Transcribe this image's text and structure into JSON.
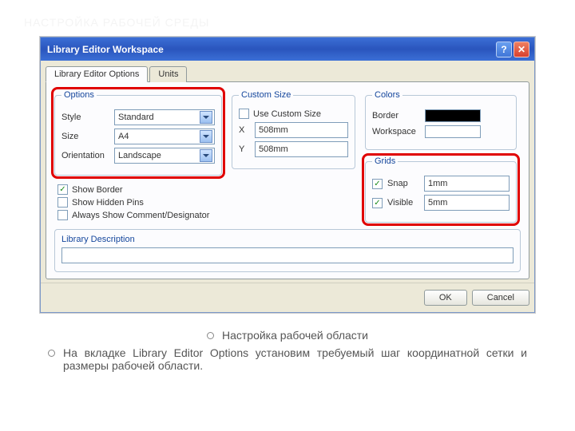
{
  "slide_title": "НАСТРОЙКА РАБОЧЕЙ СРЕДЫ",
  "dialog": {
    "title": "Library Editor Workspace",
    "tabs": {
      "options": "Library Editor Options",
      "units": "Units"
    },
    "options_group": {
      "legend": "Options",
      "style_label": "Style",
      "style_value": "Standard",
      "size_label": "Size",
      "size_value": "A4",
      "orientation_label": "Orientation",
      "orientation_value": "Landscape"
    },
    "check_border": "Show Border",
    "check_hidden": "Show Hidden Pins",
    "check_comment": "Always Show Comment/Designator",
    "custom_group": {
      "legend": "Custom Size",
      "use_label": "Use Custom Size",
      "x_label": "X",
      "x_value": "508mm",
      "y_label": "Y",
      "y_value": "508mm"
    },
    "colors_group": {
      "legend": "Colors",
      "border_label": "Border",
      "workspace_label": "Workspace"
    },
    "grids_group": {
      "legend": "Grids",
      "snap_label": "Snap",
      "snap_value": "1mm",
      "visible_label": "Visible",
      "visible_value": "5mm"
    },
    "lib_desc_label": "Library Description",
    "ok": "OK",
    "cancel": "Cancel"
  },
  "bullets": {
    "b1": "Настройка рабочей области",
    "b2": "На вкладке Library Editor Options установим требуемый шаг координатной сетки и размеры рабочей области."
  }
}
